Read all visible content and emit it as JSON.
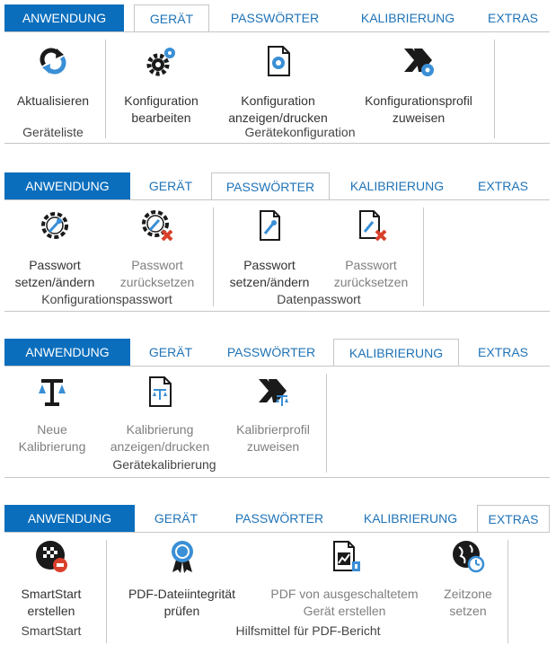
{
  "ribbon1": {
    "tabs": [
      "ANWENDUNG",
      "GERÄT",
      "PASSWÖRTER",
      "KALIBRIERUNG",
      "EXTRAS"
    ],
    "buttons": [
      {
        "label": "Aktualisieren",
        "icon": "refresh-icon"
      },
      {
        "label": "Konfiguration\nbearbeiten",
        "icon": "gear-edit-icon"
      },
      {
        "label": "Konfiguration\nanzeigen/drucken",
        "icon": "config-document-icon"
      },
      {
        "label": "Konfigurationsprofil\nzuweisen",
        "icon": "assign-config-profile-icon"
      }
    ],
    "groups": [
      "Geräteliste",
      "Gerätekonfiguration"
    ]
  },
  "ribbon2": {
    "tabs": [
      "ANWENDUNG",
      "GERÄT",
      "PASSWÖRTER",
      "KALIBRIERUNG",
      "EXTRAS"
    ],
    "buttons": [
      {
        "label": "Passwort\nsetzen/ändern",
        "icon": "gear-key-icon"
      },
      {
        "label": "Passwort\nzurücksetzen",
        "icon": "gear-key-reset-icon"
      },
      {
        "label": "Passwort\nsetzen/ändern",
        "icon": "document-key-icon"
      },
      {
        "label": "Passwort\nzurücksetzen",
        "icon": "document-key-reset-icon"
      }
    ],
    "groups": [
      "Konfigurationspasswort",
      "Datenpasswort"
    ]
  },
  "ribbon3": {
    "tabs": [
      "ANWENDUNG",
      "GERÄT",
      "PASSWÖRTER",
      "KALIBRIERUNG",
      "EXTRAS"
    ],
    "buttons": [
      {
        "label": "Neue\nKalibrierung",
        "icon": "scale-icon"
      },
      {
        "label": "Kalibrierung\nanzeigen/drucken",
        "icon": "scale-document-icon"
      },
      {
        "label": "Kalibrierprofil\nzuweisen",
        "icon": "assign-calibration-profile-icon"
      }
    ],
    "groups": [
      "Gerätekalibrierung"
    ]
  },
  "ribbon4": {
    "tabs": [
      "ANWENDUNG",
      "GERÄT",
      "PASSWÖRTER",
      "KALIBRIERUNG",
      "EXTRAS"
    ],
    "buttons": [
      {
        "label": "SmartStart\nerstellen",
        "icon": "smartstart-icon"
      },
      {
        "label": "PDF-Dateiintegrität\nprüfen",
        "icon": "badge-icon"
      },
      {
        "label": "PDF von ausgeschaltetem\nGerät erstellen",
        "icon": "pdf-chart-icon"
      },
      {
        "label": "Zeitzone\nsetzen",
        "icon": "globe-clock-icon"
      }
    ],
    "groups": [
      "SmartStart",
      "Hilfsmittel für PDF-Bericht"
    ]
  },
  "colors": {
    "app_tab": "#0a6ebd",
    "tab_text": "#1f73b7",
    "accent_blue": "#3a8fd6",
    "red": "#d9402b"
  }
}
